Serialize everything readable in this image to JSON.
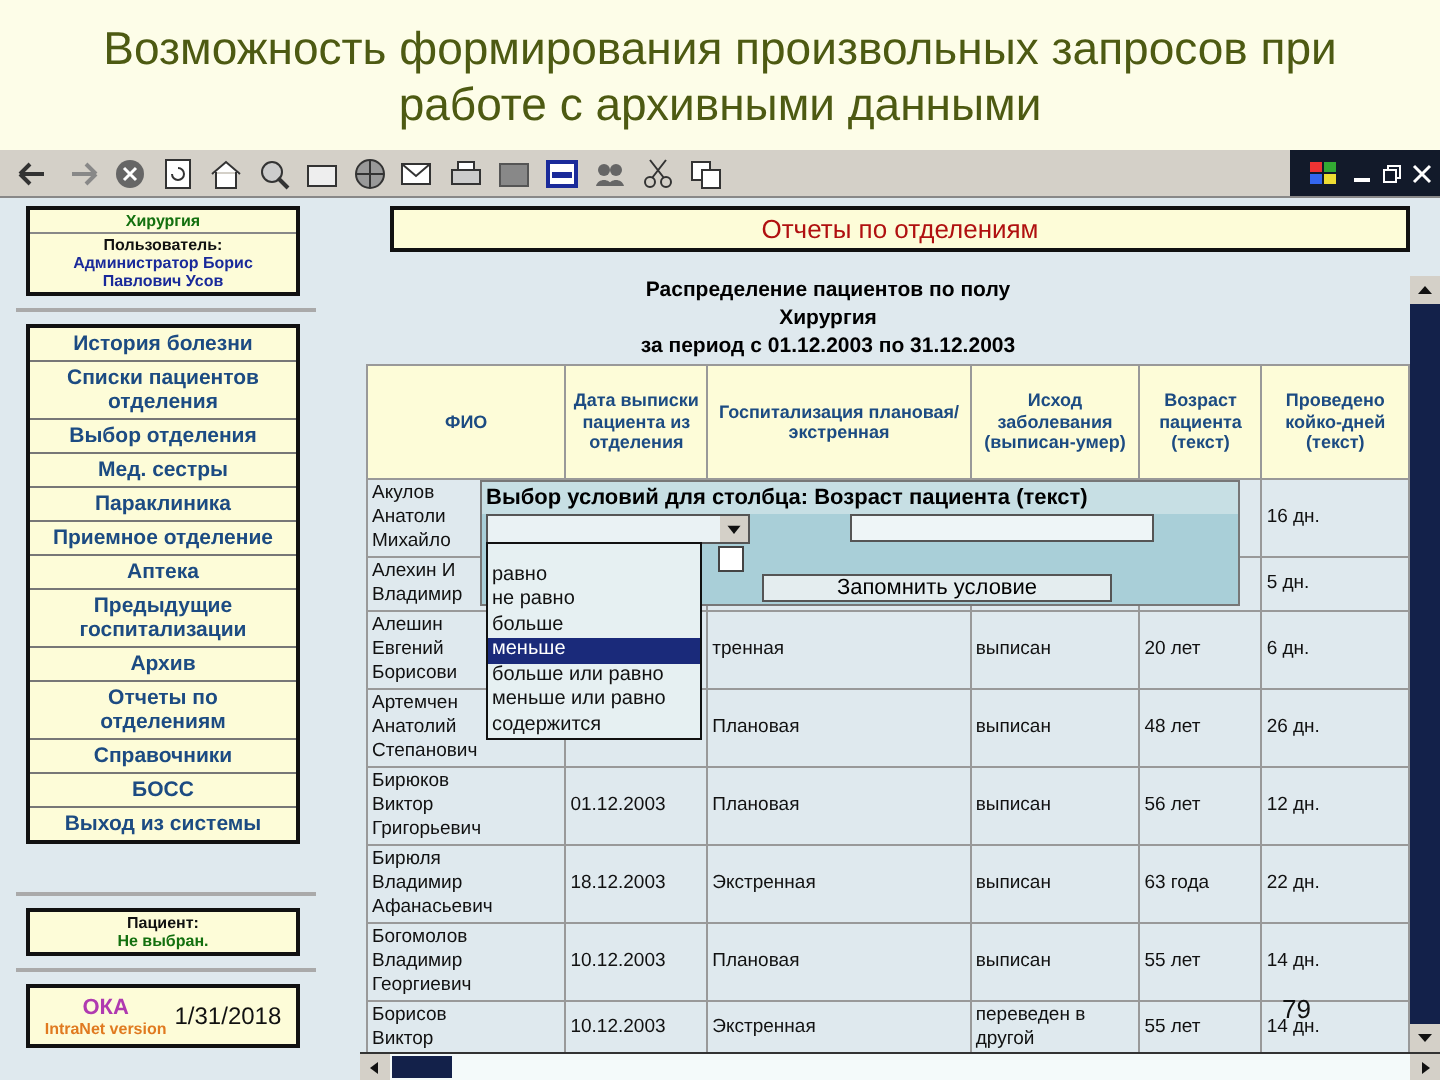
{
  "slide": {
    "title": "Возможность формирования произвольных запросов при работе с архивными данными",
    "date": "1/31/2018",
    "page_number": "79"
  },
  "sidebar": {
    "department": "Хирургия",
    "user_label": "Пользователь:",
    "user_name": "Администратор Борис Павлович Усов",
    "menu": [
      "История болезни",
      "Списки пациентов отделения",
      "Выбор отделения",
      "Мед. сестры",
      "Параклиника",
      "Приемное отделение",
      "Аптека",
      "Предыдущие госпитализации",
      "Архив",
      "Отчеты по отделениям",
      "Справочники",
      "БОСС",
      "Выход из системы"
    ],
    "patient_label": "Пациент:",
    "patient_value": "Не выбран.",
    "logo": "ОКА",
    "logo_caption": "IntraNet version"
  },
  "page_title": "Отчеты по отделениям",
  "report": {
    "title_lines": [
      "Распределение пациентов по полу",
      "Хирургия",
      "за период с 01.12.2003 по 31.12.2003"
    ],
    "columns": [
      "ФИО",
      "Дата выписки пациента из отделения",
      "Госпитализация плановая/экстренная",
      "Исход заболевания (выписан-умер)",
      "Возраст пациента (текст)",
      "Проведено койко-дней (текст)"
    ],
    "rows": [
      {
        "name": "Акулов\nАнатоли\nМихайло",
        "days": "16 дн."
      },
      {
        "name": "Алехин И\nВладимир",
        "days": "5 дн."
      },
      {
        "name": "Алешин\nЕвгений\nБорисови",
        "admission": "тренная",
        "outcome": "выписан",
        "age": "20 лет",
        "days": "6 дн."
      },
      {
        "name": "Артемчен\nАнатолий\nСтепанович",
        "admission": "Плановая",
        "outcome": "выписан",
        "age": "48 лет",
        "days": "26 дн."
      },
      {
        "name": "Бирюков\nВиктор\nГригорьевич",
        "date": "01.12.2003",
        "admission": "Плановая",
        "outcome": "выписан",
        "age": "56 лет",
        "days": "12 дн."
      },
      {
        "name": "Бирюля\nВладимир\nАфанасьевич",
        "date": "18.12.2003",
        "admission": "Экстренная",
        "outcome": "выписан",
        "age": "63 года",
        "days": "22 дн."
      },
      {
        "name": "Богомолов\nВладимир\nГеоргиевич",
        "date": "10.12.2003",
        "admission": "Плановая",
        "outcome": "выписан",
        "age": "55 лет",
        "days": "14 дн."
      },
      {
        "name": "Борисов\nВиктор",
        "date": "10.12.2003",
        "admission": "Экстренная",
        "outcome": "переведен в\nдругой",
        "age": "55 лет",
        "days": "14 дн."
      }
    ]
  },
  "condition_dialog": {
    "title": "Выбор условий для столбца: Возраст пациента (текст)",
    "checkbox": {
      "checked": false
    },
    "button": "Запомнить условие",
    "options": [
      {
        "label": "равно",
        "selected": false
      },
      {
        "label": "не равно",
        "selected": false
      },
      {
        "label": "больше",
        "selected": false
      },
      {
        "label": "меньше",
        "selected": true
      },
      {
        "label": "больше или равно",
        "selected": false
      },
      {
        "label": "меньше или равно",
        "selected": false
      },
      {
        "label": "содержится",
        "selected": false
      }
    ]
  }
}
